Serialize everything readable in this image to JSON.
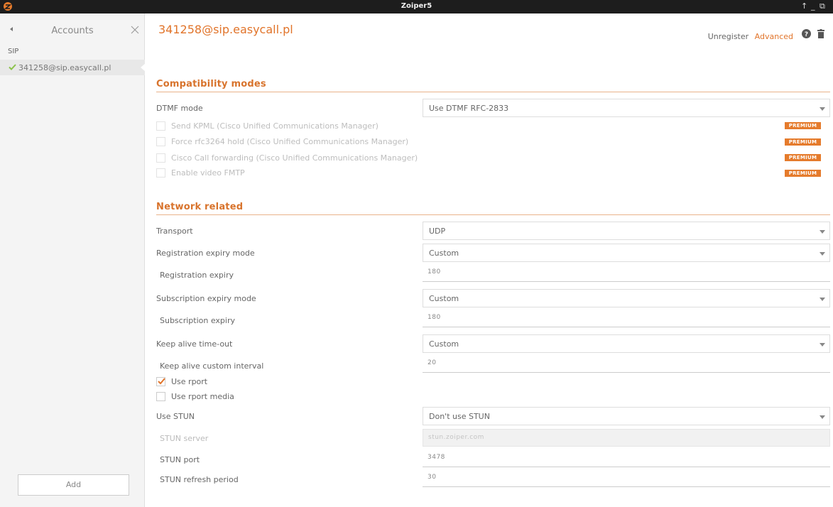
{
  "window": {
    "title": "Zoiper5",
    "controls": {
      "up": "↑",
      "minimize": "_",
      "restore": "⧉"
    }
  },
  "sidebar": {
    "title": "Accounts",
    "section": "SIP",
    "accounts": [
      {
        "label": "341258@sip.easycall.pl",
        "status": "registered"
      }
    ],
    "add_label": "Add"
  },
  "account": {
    "title": "341258@sip.easycall.pl",
    "actions": {
      "unregister": "Unregister",
      "advanced": "Advanced"
    }
  },
  "compatibility": {
    "title": "Compatibility modes",
    "dtmf_label": "DTMF mode",
    "dtmf_value": "Use DTMF RFC-2833",
    "options": [
      {
        "label": "Send KPML (Cisco Unified Communications Manager)",
        "badge": "PREMIUM"
      },
      {
        "label": "Force rfc3264 hold (Cisco Unified Communications Manager)",
        "badge": "PREMIUM"
      },
      {
        "label": "Cisco Call forwarding (Cisco Unified Communications Manager)",
        "badge": "PREMIUM"
      },
      {
        "label": "Enable video FMTP",
        "badge": "PREMIUM"
      }
    ]
  },
  "network": {
    "title": "Network related",
    "transport_label": "Transport",
    "transport_value": "UDP",
    "reg_mode_label": "Registration expiry mode",
    "reg_mode_value": "Custom",
    "reg_expiry_label": "Registration expiry",
    "reg_expiry_value": "180",
    "sub_mode_label": "Subscription expiry mode",
    "sub_mode_value": "Custom",
    "sub_expiry_label": "Subscription expiry",
    "sub_expiry_value": "180",
    "keepalive_label": "Keep alive time-out",
    "keepalive_value": "Custom",
    "keepalive_interval_label": "Keep alive custom interval",
    "keepalive_interval_value": "20",
    "use_rport_label": "Use rport",
    "use_rport_checked": true,
    "use_rport_media_label": "Use rport media",
    "use_rport_media_checked": false,
    "stun_label": "Use STUN",
    "stun_value": "Don't use STUN",
    "stun_server_label": "STUN server",
    "stun_server_value": "stun.zoiper.com",
    "stun_port_label": "STUN port",
    "stun_port_value": "3478",
    "stun_refresh_label": "STUN refresh period",
    "stun_refresh_value": "30"
  },
  "colors": {
    "accent": "#e1742a",
    "premium": "#e57b2c",
    "check": "#8bc34a"
  }
}
